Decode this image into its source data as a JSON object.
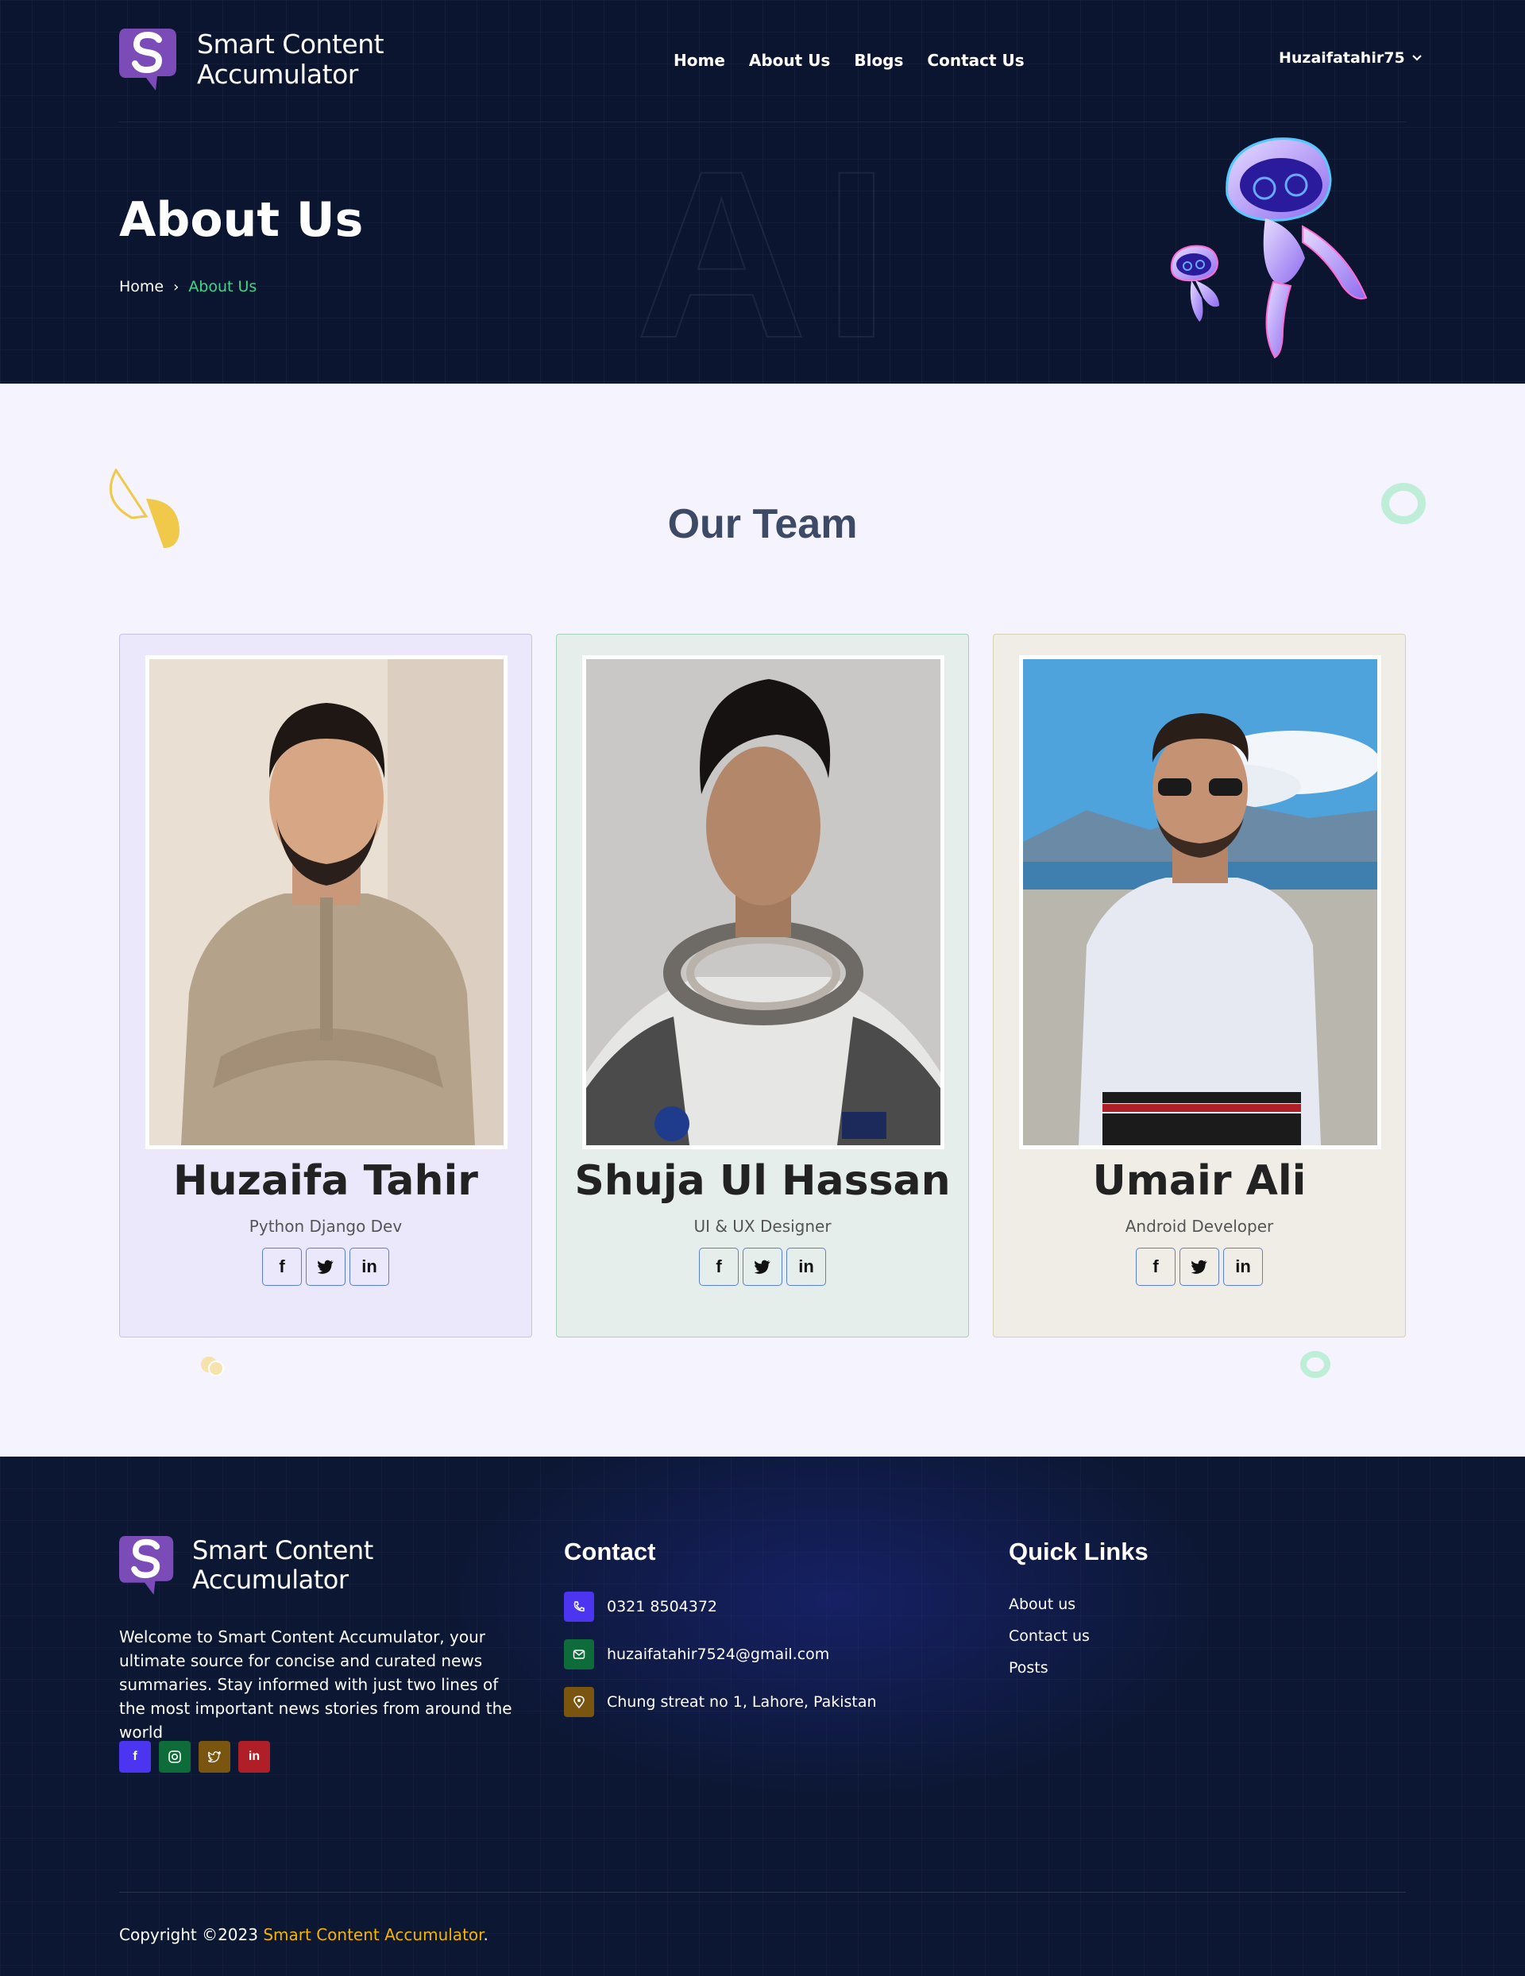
{
  "header": {
    "logo_text_line1": "Smart Content",
    "logo_text_line2": "Accumulator",
    "nav": [
      "Home",
      "About Us",
      "Blogs",
      "Contact Us"
    ],
    "user": "Huzaifatahir75",
    "watermark": "AI"
  },
  "hero": {
    "title": "About Us",
    "breadcrumb": {
      "home": "Home",
      "current": "About Us"
    }
  },
  "team": {
    "title": "Our Team",
    "members": [
      {
        "name": "Huzaifa Tahir",
        "role": "Python Django Dev",
        "bg": "#ebe8fc",
        "border": "#c9c2e8"
      },
      {
        "name": "Shuja Ul Hassan",
        "role": "UI & UX Designer",
        "bg": "#e5eeea",
        "border": "#a6d2b6"
      },
      {
        "name": "Umair Ali",
        "role": "Android Developer",
        "bg": "#f0ede6",
        "border": "#d6d0b4"
      }
    ],
    "social_icons": [
      "facebook-icon",
      "twitter-icon",
      "linkedin-icon"
    ]
  },
  "footer": {
    "logo_text_line1": "Smart Content",
    "logo_text_line2": "Accumulator",
    "description": "Welcome to Smart Content Accumulator, your ultimate source for concise and curated news summaries. Stay informed with just two lines of the most important news stories from around the world",
    "social_colors": [
      "#4b35f0",
      "#0e6b3a",
      "#7a5510",
      "#b01f28"
    ],
    "contact_title": "Contact",
    "phone": "0321 8504372",
    "email": "huzaifatahir7524@gmail.com",
    "address": "Chung streat no 1, Lahore, Pakistan",
    "quick_links_title": "Quick Links",
    "quick_links": [
      "About us",
      "Contact us",
      "Posts"
    ],
    "copyright_prefix": "Copyright ©2023 ",
    "copyright_brand": "Smart Content Accumulator",
    "copyright_suffix": "."
  },
  "colors": {
    "hero_bg": "#0b1530",
    "breadcrumb_active": "#3fd68a",
    "logo_purple": "#7b4bb8",
    "brand_accent": "#f5b400"
  }
}
